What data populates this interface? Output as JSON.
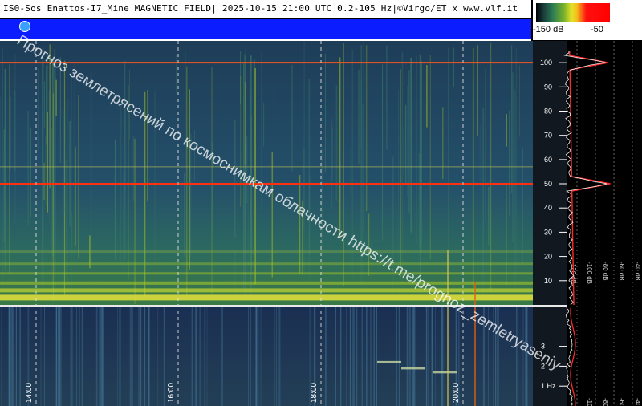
{
  "header": {
    "title": "IS0-Sos Enattos-I7_Mine MAGNETIC FIELD| 2025-10-15 21:00 UTC 0.2-105 Hz|©Virgo/ET x www.vlf.it",
    "scale_min_label": "-150 dB",
    "scale_max_label": "-50",
    "colors": {
      "title_bg": "#ffffff",
      "band": "#0b1cff"
    }
  },
  "watermark": {
    "text": "Прогноз землетрясений по космоснимкам облачности  https://t.me/prognoz_zemletryaseniy",
    "icon": "telegram-icon"
  },
  "chart_data": [
    {
      "type": "heatmap",
      "title": "",
      "xlabel": "",
      "ylabel": "",
      "x_ticks": [
        "14:00",
        "16:00",
        "18:00",
        "20:00"
      ],
      "panels": [
        {
          "name": "upper",
          "ylim": [
            0,
            105
          ],
          "y_ticks": [
            10,
            20,
            30,
            40,
            50,
            60,
            70,
            80,
            90,
            100
          ]
        },
        {
          "name": "lower",
          "ylim": [
            0,
            5
          ],
          "y_ticks": [
            1,
            2,
            3
          ],
          "y_unit_label": "1 Hz"
        }
      ],
      "strong_lines_hz": [
        50,
        100
      ],
      "grid": true
    },
    {
      "type": "line",
      "title": "",
      "xlabel": "",
      "ylabel": "",
      "x_ticks": [
        "-120 dB",
        "-100 dB",
        "-80 dB",
        "-60 dB",
        "-40 dB"
      ],
      "y_range": [
        0,
        105
      ],
      "peaks_hz": [
        50,
        100
      ],
      "grid": true
    }
  ]
}
